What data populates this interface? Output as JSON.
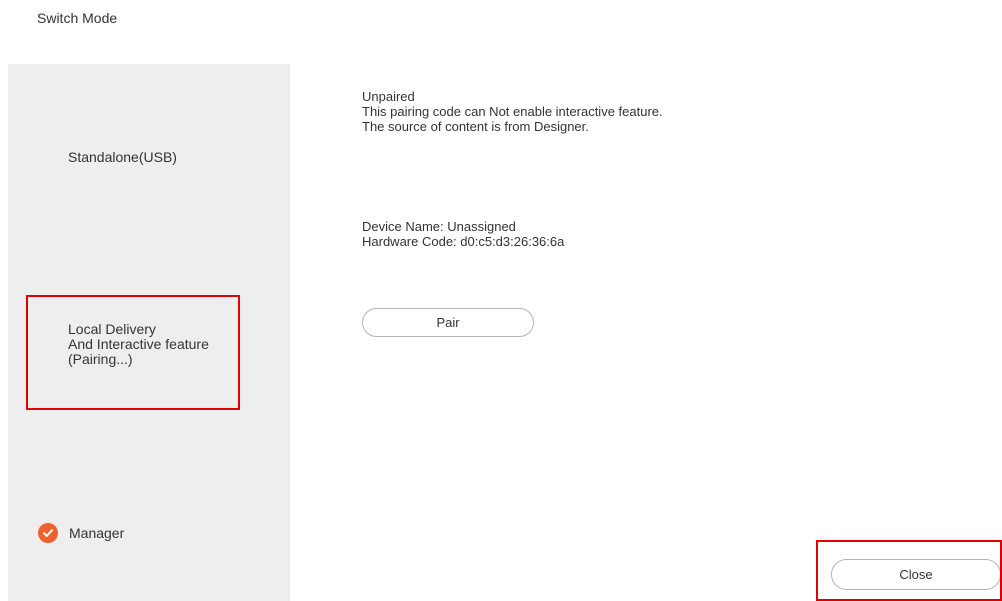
{
  "dialog": {
    "title": "Switch Mode"
  },
  "sidebar": {
    "items": [
      {
        "lines": [
          "Standalone(USB)"
        ]
      },
      {
        "lines": [
          "Local Delivery",
          "And Interactive feature",
          "(Pairing...)"
        ]
      },
      {
        "label": "Manager",
        "icon": "checkmark-circle-icon",
        "selected": true
      }
    ]
  },
  "main": {
    "status_lines": [
      "Unpaired",
      "This pairing code can Not enable interactive feature.",
      "The source of content is from Designer."
    ],
    "device_lines": [
      "Device Name: Unassigned",
      "Hardware Code: d0:c5:d3:26:36:6a"
    ],
    "pair_label": "Pair"
  },
  "footer": {
    "close_label": "Close"
  },
  "colors": {
    "accent": "#f0622d",
    "sidebar_bg": "#eeeeee",
    "highlight": "#e00000"
  }
}
